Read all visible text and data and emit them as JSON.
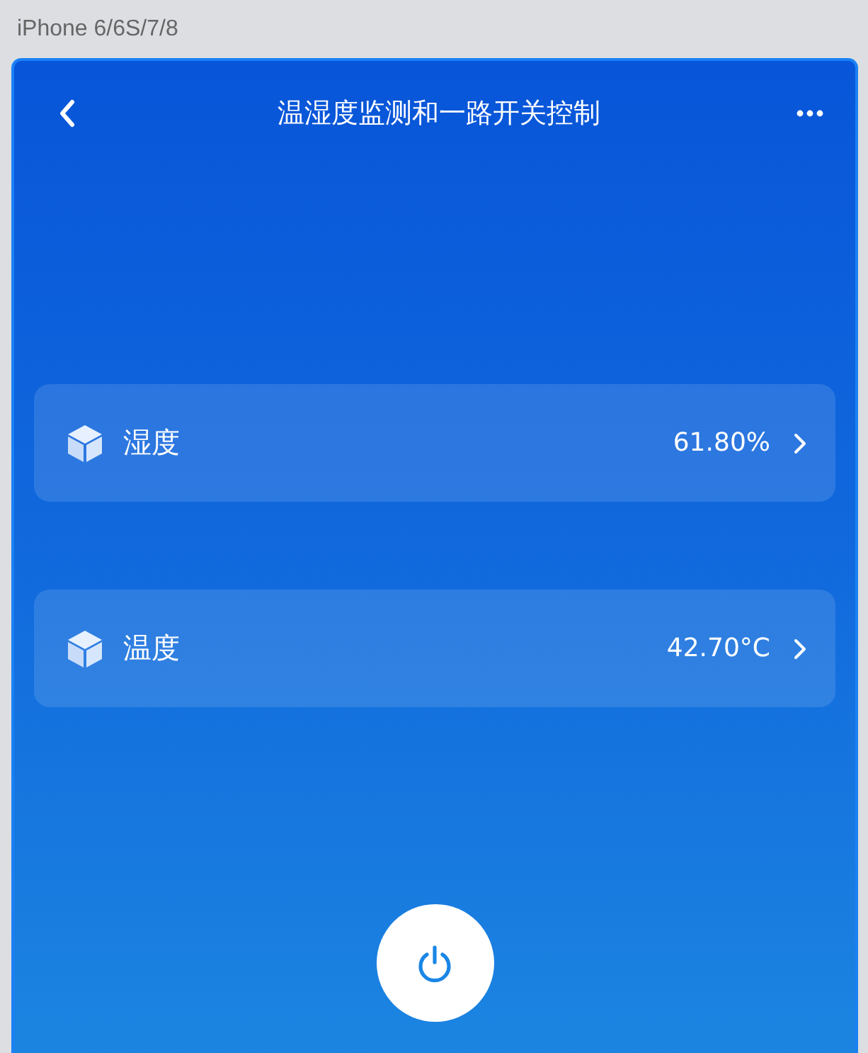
{
  "device_label": "iPhone 6/6S/7/8",
  "header": {
    "title": "温湿度监测和一路开关控制"
  },
  "sensors": [
    {
      "name": "湿度",
      "value": "61.80%"
    },
    {
      "name": "温度",
      "value": "42.70°C"
    }
  ]
}
